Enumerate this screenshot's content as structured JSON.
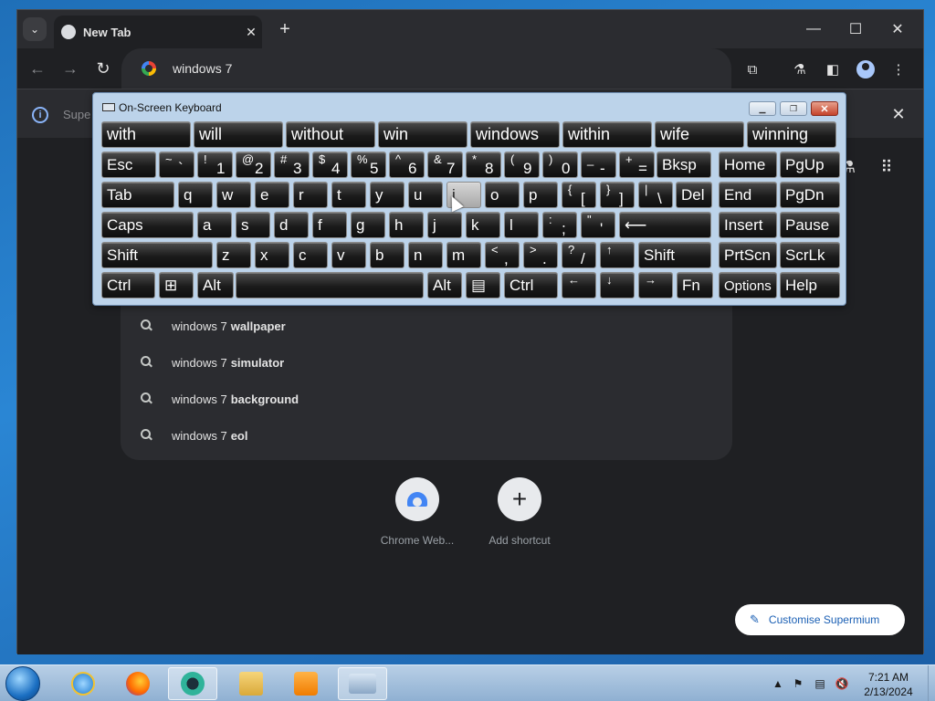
{
  "browser": {
    "tab_title": "New Tab",
    "tab_close": "✕",
    "new_tab": "+",
    "window_controls": {
      "minimize": "—",
      "maximize": "☐",
      "close": "✕"
    },
    "omnibox_text": "windows 7",
    "infobar_text": "Supe",
    "infobar_icon": "i",
    "infobar_close": "✕"
  },
  "suggestions": [
    {
      "base": "windows 7",
      "bold": "wallpaper"
    },
    {
      "base": "windows 7",
      "bold": "simulator"
    },
    {
      "base": "windows 7",
      "bold": "background"
    },
    {
      "base": "windows 7",
      "bold": "eol"
    }
  ],
  "shortcuts": [
    {
      "label": "Chrome Web..."
    },
    {
      "label": "Add shortcut",
      "glyph": "+"
    }
  ],
  "customise_label": "Customise Supermium",
  "osk": {
    "title": "On-Screen Keyboard",
    "predictions": [
      "with",
      "will",
      "without",
      "win",
      "windows",
      "within",
      "wife",
      "winning"
    ],
    "row1": [
      {
        "m": "Esc"
      },
      {
        "s": "~",
        "m": "`"
      },
      {
        "s": "!",
        "m": "1"
      },
      {
        "s": "@",
        "m": "2"
      },
      {
        "s": "#",
        "m": "3"
      },
      {
        "s": "$",
        "m": "4"
      },
      {
        "s": "%",
        "m": "5"
      },
      {
        "s": "^",
        "m": "6"
      },
      {
        "s": "&",
        "m": "7"
      },
      {
        "s": "*",
        "m": "8"
      },
      {
        "s": "(",
        "m": "9"
      },
      {
        "s": ")",
        "m": "0"
      },
      {
        "s": "_",
        "m": "-"
      },
      {
        "s": "+",
        "m": "="
      },
      {
        "m": "Bksp"
      },
      {
        "m": "Home"
      },
      {
        "m": "PgUp"
      }
    ],
    "row2": [
      {
        "m": "Tab"
      },
      {
        "m": "q"
      },
      {
        "m": "w"
      },
      {
        "m": "e"
      },
      {
        "m": "r"
      },
      {
        "m": "t"
      },
      {
        "m": "y"
      },
      {
        "m": "u"
      },
      {
        "m": "i"
      },
      {
        "m": "o"
      },
      {
        "m": "p"
      },
      {
        "s": "{",
        "m": "["
      },
      {
        "s": "}",
        "m": "]"
      },
      {
        "s": "|",
        "m": "\\"
      },
      {
        "m": "Del"
      },
      {
        "m": "End"
      },
      {
        "m": "PgDn"
      }
    ],
    "row3": [
      {
        "m": "Caps"
      },
      {
        "m": "a"
      },
      {
        "m": "s"
      },
      {
        "m": "d"
      },
      {
        "m": "f"
      },
      {
        "m": "g"
      },
      {
        "m": "h"
      },
      {
        "m": "j"
      },
      {
        "m": "k"
      },
      {
        "m": "l"
      },
      {
        "s": ":",
        "m": ";"
      },
      {
        "s": "\"",
        "m": "'"
      },
      {
        "m": "⟵"
      },
      {
        "m": "Insert"
      },
      {
        "m": "Pause"
      }
    ],
    "row4": [
      {
        "m": "Shift"
      },
      {
        "m": "z"
      },
      {
        "m": "x"
      },
      {
        "m": "c"
      },
      {
        "m": "v"
      },
      {
        "m": "b"
      },
      {
        "m": "n"
      },
      {
        "m": "m"
      },
      {
        "s": "<",
        "m": ","
      },
      {
        "s": ">",
        "m": "."
      },
      {
        "s": "?",
        "m": "/"
      },
      {
        "s": "↑",
        "m": ""
      },
      {
        "m": "Shift"
      },
      {
        "m": "PrtScn"
      },
      {
        "m": "ScrLk"
      }
    ],
    "row5": [
      {
        "m": "Ctrl"
      },
      {
        "m": "⊞"
      },
      {
        "m": "Alt"
      },
      {
        "m": ""
      },
      {
        "m": "Alt"
      },
      {
        "m": "▤"
      },
      {
        "m": "Ctrl"
      },
      {
        "s": "←",
        "m": ""
      },
      {
        "s": "↓",
        "m": ""
      },
      {
        "s": "→",
        "m": ""
      },
      {
        "m": "Fn"
      },
      {
        "m": "Options"
      },
      {
        "m": "Help"
      }
    ]
  },
  "taskbar": {
    "time": "7:21 AM",
    "date": "2/13/2024"
  }
}
